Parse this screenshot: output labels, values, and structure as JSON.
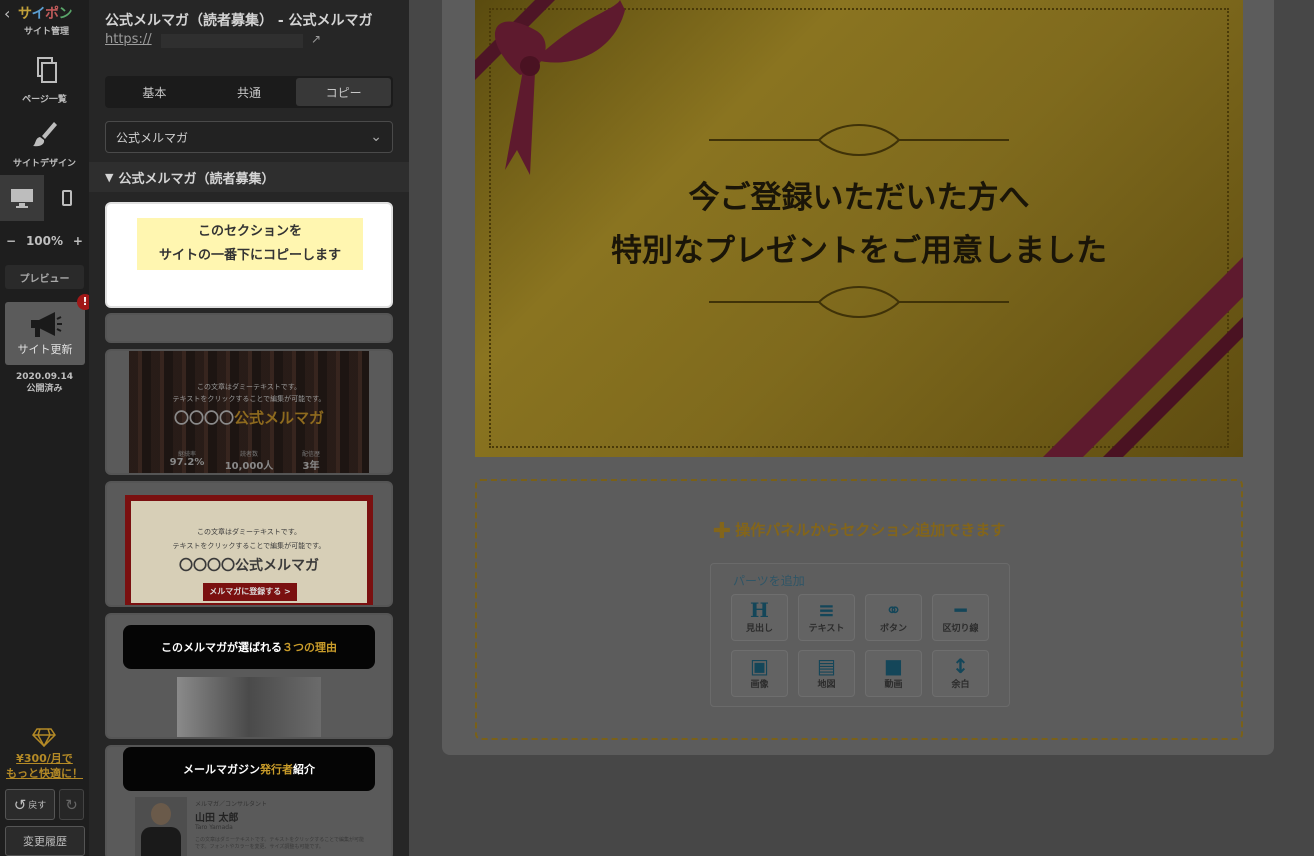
{
  "rail": {
    "logo_chars": [
      "サ",
      "イ",
      "ポ",
      "ン",
      ""
    ],
    "logo_sub": "サイト管理",
    "pages_label": "ページ一覧",
    "design_label": "サイトデザイン",
    "zoom_minus": "−",
    "zoom_value": "100%",
    "zoom_plus": "+",
    "preview_label": "プレビュー",
    "update_label": "サイト更新",
    "update_alert": "!",
    "publish_date": "2020.09.14",
    "publish_status": "公開済み",
    "promo_line1": "¥300/月で",
    "promo_line2": "もっと快適に！",
    "undo_label": "戻す",
    "history_label": "変更履歴"
  },
  "panel": {
    "title": "公式メルマガ（読者募集） - 公式メルマガ",
    "url": "https://",
    "tabs": [
      "基本",
      "共通",
      "コピー"
    ],
    "active_tab": "コピー",
    "select_value": "公式メルマガ",
    "section_title": "公式メルマガ（読者募集）",
    "copy_tip_line1": "このセクションを",
    "copy_tip_line2": "サイトの一番下にコピーします",
    "thumb1": {
      "line1": "この文章はダミーテキストです。",
      "line2": "テキストをクリックすることで編集が可能です。",
      "brand_prefix": "〇〇〇〇",
      "brand_suffix": "公式メルマガ",
      "stats": [
        {
          "label": "継続率",
          "value": "97.2%"
        },
        {
          "label": "読者数",
          "value": "10,000人"
        },
        {
          "label": "配信歴",
          "value": "3年"
        }
      ]
    },
    "thumb2": {
      "line1": "この文章はダミーテキストです。",
      "line2": "テキストをクリックすることで編集が可能です。",
      "brand": "〇〇〇〇公式メルマガ",
      "cta": "メルマガに登録する >"
    },
    "thumb3": {
      "pre": "このメルマガが選ばれる",
      "em": "３つの理由"
    },
    "thumb4": {
      "pre": "メールマガジン",
      "em": "発行者",
      "post": "紹介",
      "role": "メルマガ／コンサルタント",
      "name": "山田 太郎",
      "romaji": "Taro Yamada",
      "bio": "この文章はダミーテキストです。テキストをクリックすることで編集が可能です。フォントやカラーを変更、サイズ調整も可能です。"
    }
  },
  "canvas": {
    "hero_line1": "今ご登録いただいた方へ",
    "hero_line2": "特別なプレゼントをご用意しました",
    "add_section": "操作パネルからセクション追加できます",
    "parts_title": "パーツを追加",
    "parts": [
      {
        "icon": "heading-icon",
        "glyph": "H",
        "label": "見出し"
      },
      {
        "icon": "text-icon",
        "glyph": "≡",
        "label": "テキスト"
      },
      {
        "icon": "link-icon",
        "glyph": "⚭",
        "label": "ボタン"
      },
      {
        "icon": "divider-icon",
        "glyph": "━",
        "label": "区切り線"
      },
      {
        "icon": "image-icon",
        "glyph": "▣",
        "label": "画像"
      },
      {
        "icon": "map-icon",
        "glyph": "▤",
        "label": "地図"
      },
      {
        "icon": "video-icon",
        "glyph": "■",
        "label": "動画"
      },
      {
        "icon": "spacer-icon",
        "glyph": "↕",
        "label": "余白"
      }
    ]
  },
  "colors": {
    "accent": "#b48a26",
    "alert": "#a01818",
    "tip_bg": "#fff6b0",
    "parts_icon": "#144659"
  }
}
